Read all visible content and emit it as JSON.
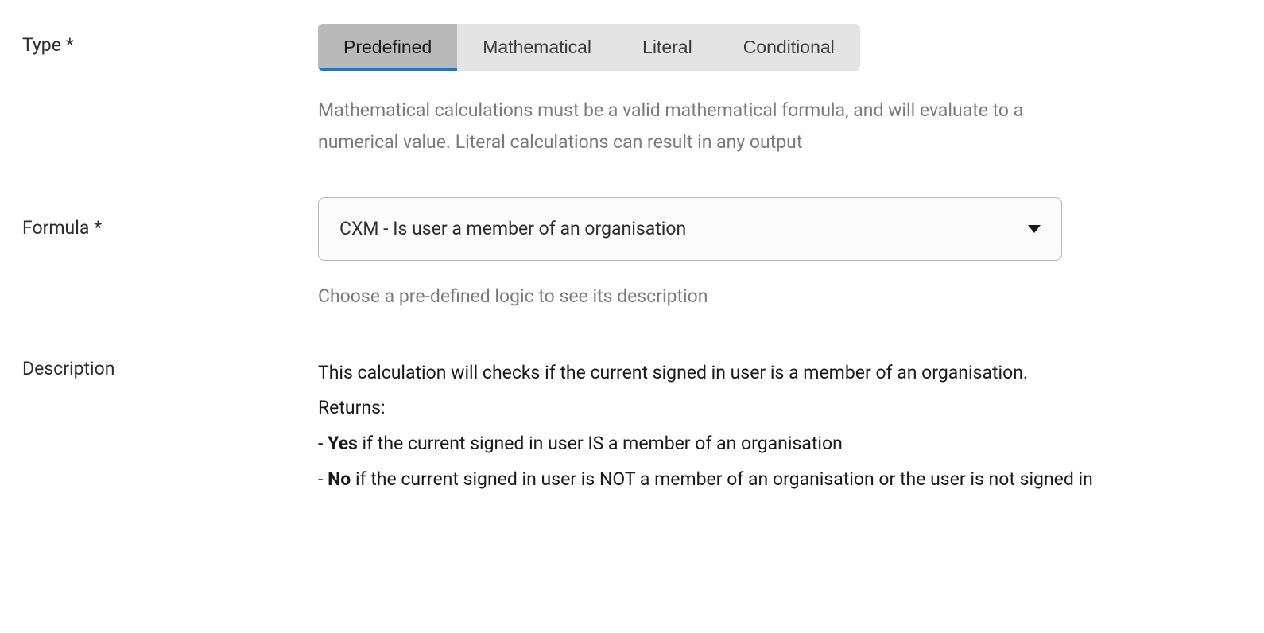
{
  "type": {
    "label": "Type",
    "required_marker": "*",
    "tabs": {
      "predefined": "Predefined",
      "mathematical": "Mathematical",
      "literal": "Literal",
      "conditional": "Conditional"
    },
    "helper": "Mathematical calculations must be a valid mathematical formula, and will evaluate to a numerical value. Literal calculations can result in any output"
  },
  "formula": {
    "label": "Formula",
    "required_marker": "*",
    "selected": "CXM - Is user a member of an organisation",
    "helper": "Choose a pre-defined logic to see its description"
  },
  "description": {
    "label": "Description",
    "line1": "This calculation will checks if the current signed in user is a member of an organisation.",
    "line2": "Returns:",
    "line3_prefix": "- ",
    "line3_bold": "Yes",
    "line3_rest": " if the current signed in user IS a member of an organisation",
    "line4_prefix": "- ",
    "line4_bold": "No",
    "line4_rest": " if the current signed in user is NOT a member of an organisation or the user is not signed in"
  }
}
